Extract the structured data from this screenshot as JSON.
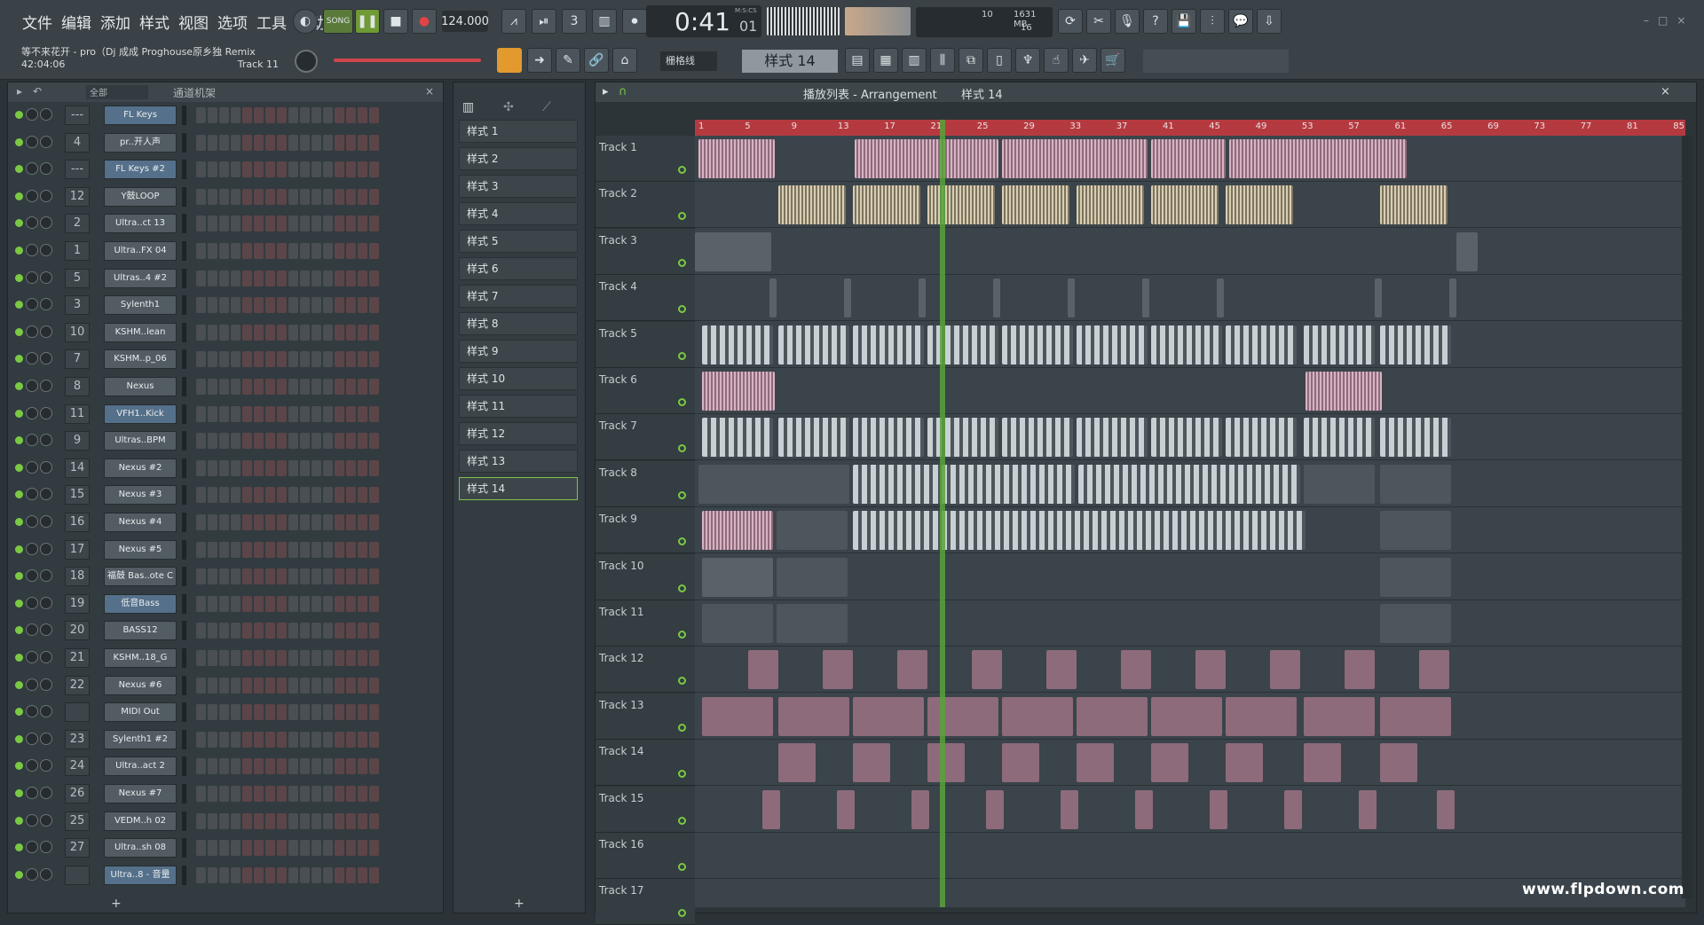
{
  "menu": [
    "文件",
    "编辑",
    "添加",
    "样式",
    "视图",
    "选项",
    "工具",
    "帮助"
  ],
  "transport": {
    "mode": "SONG",
    "tempo": "124.000",
    "time": "0:41",
    "time_sub": "01",
    "time_label": "M:S:CS",
    "cpu": "10",
    "memory": "1631 MB",
    "voices": "16"
  },
  "song_info": {
    "title": "等不来花开 - pro（Dj 成成 Proghouse原乡独 Remix",
    "time": "42:04:06",
    "track": "Track 11"
  },
  "toolbar": {
    "snap": "栅格线",
    "pattern": "样式 14"
  },
  "rack": {
    "filter": "全部",
    "title": "通道机架",
    "channels": [
      {
        "num": "---",
        "name": "FL Keys",
        "blue": true
      },
      {
        "num": "4",
        "name": "pr..开人声",
        "blue": false
      },
      {
        "num": "---",
        "name": "FL Keys #2",
        "blue": true
      },
      {
        "num": "12",
        "name": "Y鼓LOOP",
        "blue": false
      },
      {
        "num": "2",
        "name": "Ultra..ct 13",
        "blue": false
      },
      {
        "num": "1",
        "name": "Ultra..FX 04",
        "blue": false
      },
      {
        "num": "5",
        "name": "Ultras..4 #2",
        "blue": false
      },
      {
        "num": "3",
        "name": "Sylenth1",
        "blue": false
      },
      {
        "num": "10",
        "name": "KSHM..lean",
        "blue": false
      },
      {
        "num": "7",
        "name": "KSHM..p_06",
        "blue": false
      },
      {
        "num": "8",
        "name": "Nexus",
        "blue": false
      },
      {
        "num": "11",
        "name": "VFH1..Kick",
        "blue": true
      },
      {
        "num": "9",
        "name": "Ultras..BPM",
        "blue": false
      },
      {
        "num": "14",
        "name": "Nexus #2",
        "blue": false
      },
      {
        "num": "15",
        "name": "Nexus #3",
        "blue": false
      },
      {
        "num": "16",
        "name": "Nexus #4",
        "blue": false
      },
      {
        "num": "17",
        "name": "Nexus #5",
        "blue": false
      },
      {
        "num": "18",
        "name": "福鼓 Bas..ote C",
        "blue": false
      },
      {
        "num": "19",
        "name": "低音Bass",
        "blue": true
      },
      {
        "num": "20",
        "name": "BASS12",
        "blue": false
      },
      {
        "num": "21",
        "name": "KSHM..18_G",
        "blue": false
      },
      {
        "num": "22",
        "name": "Nexus #6",
        "blue": false
      },
      {
        "num": "",
        "name": "MIDI Out",
        "blue": false
      },
      {
        "num": "23",
        "name": "Sylenth1 #2",
        "blue": false
      },
      {
        "num": "24",
        "name": "Ultra..act 2",
        "blue": false
      },
      {
        "num": "26",
        "name": "Nexus #7",
        "blue": false
      },
      {
        "num": "25",
        "name": "VEDM..h 02",
        "blue": false
      },
      {
        "num": "27",
        "name": "Ultra..sh 08",
        "blue": false
      },
      {
        "num": "",
        "name": "Ultra..8 - 音量",
        "blue": true
      }
    ]
  },
  "patterns": [
    "样式 1",
    "样式 2",
    "样式 3",
    "样式 4",
    "样式 5",
    "样式 6",
    "样式 7",
    "样式 8",
    "样式 9",
    "样式 10",
    "样式 11",
    "样式 12",
    "样式 13",
    "样式 14"
  ],
  "playlist": {
    "title": "播放列表 - Arrangement",
    "pattern": "样式 14",
    "bars": [
      "1",
      "5",
      "9",
      "13",
      "17",
      "21",
      "25",
      "29",
      "33",
      "37",
      "41",
      "45",
      "49",
      "53",
      "57",
      "61",
      "65",
      "69",
      "73",
      "77",
      "81",
      "85"
    ],
    "tracks": [
      "Track 1",
      "Track 2",
      "Track 3",
      "Track 4",
      "Track 5",
      "Track 6",
      "Track 7",
      "Track 8",
      "Track 9",
      "Track 10",
      "Track 11",
      "Track 12",
      "Track 13",
      "Track 14",
      "Track 15",
      "Track 16",
      "Track 17"
    ]
  },
  "watermark": "www.flpdown.com"
}
